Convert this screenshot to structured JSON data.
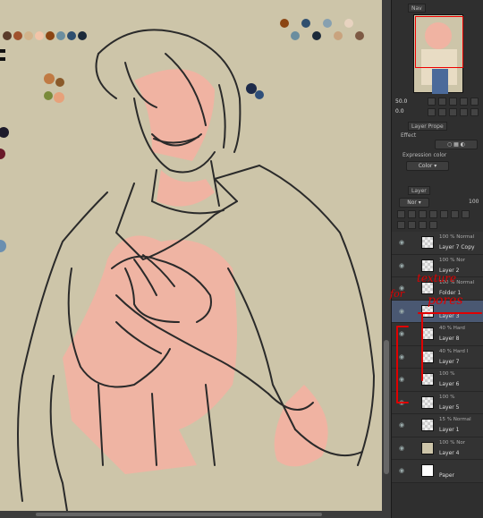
{
  "canvas": {
    "bg": "#cdc5a9",
    "skin": "#f0b3a2",
    "line": "#2a2a2a"
  },
  "palette_colors": [
    "#5a3b2a",
    "#a0522d",
    "#d2b48c",
    "#f2c4a8",
    "#8b4513",
    "#6b8e9f",
    "#2f4f6f",
    "#1c2a3a",
    "#87a0b0",
    "#c9a37e",
    "#e8d3c0",
    "#7d5a44"
  ],
  "navigator": {
    "title": "Nav",
    "zoom": "50.0",
    "rotation": "0.0"
  },
  "layer_property": {
    "title": "Layer Prope",
    "effect_label": "Effect",
    "expression_label": "Expression color",
    "expression_value": "Color"
  },
  "layer_panel": {
    "title": "Layer",
    "blend_mode": "Nor",
    "opacity": "100",
    "layers": [
      {
        "meta": "100 % Normal",
        "name": "Layer 7 Copy",
        "visible": true
      },
      {
        "meta": "100 % Nor",
        "name": "Layer 2",
        "visible": true
      },
      {
        "meta": "100 % Normal",
        "name": "Folder 1",
        "visible": true
      },
      {
        "meta": "",
        "name": "Layer 3",
        "visible": true,
        "selected": true
      },
      {
        "meta": "40 % Hard",
        "name": "Layer 8",
        "visible": true
      },
      {
        "meta": "40 % Hard l",
        "name": "Layer 7",
        "visible": true
      },
      {
        "meta": "100 %",
        "name": "Layer 6",
        "visible": true
      },
      {
        "meta": "100 %",
        "name": "Layer 5",
        "visible": true
      },
      {
        "meta": "15 % Normal",
        "name": "Layer 1",
        "visible": true
      },
      {
        "meta": "100 % Nor",
        "name": "Layer 4",
        "visible": true
      },
      {
        "meta": "",
        "name": "Paper",
        "visible": true
      }
    ]
  },
  "annotation": {
    "line1": "texture",
    "line2": "for",
    "line3": "pores"
  }
}
